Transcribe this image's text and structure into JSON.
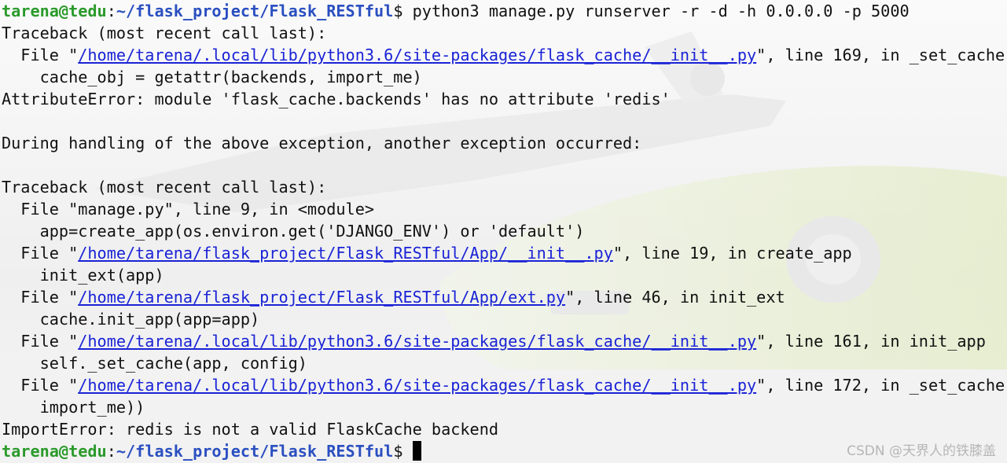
{
  "prompt": {
    "user_host": "tarena@tedu",
    "colon": ":",
    "path": "~/flask_project/Flask_RESTful",
    "symbol": "$",
    "command": " python3 manage.py runserver -r -d -h 0.0.0.0 -p 5000"
  },
  "output": {
    "tb1_header": "Traceback (most recent call last):",
    "tb1_file_pre": "  File \"",
    "tb1_file_link": "/home/tarena/.local/lib/python3.6/site-packages/flask_cache/__init__.py",
    "tb1_file_post": "\", line 169, in _set_cache",
    "tb1_code": "    cache_obj = getattr(backends, import_me)",
    "tb1_error": "AttributeError: module 'flask_cache.backends' has no attribute 'redis'",
    "during": "During handling of the above exception, another exception occurred:",
    "tb2_header": "Traceback (most recent call last):",
    "f1": "  File \"manage.py\", line 9, in <module>",
    "f1_code": "    app=create_app(os.environ.get('DJANGO_ENV') or 'default')",
    "f2_pre": "  File \"",
    "f2_link": "/home/tarena/flask_project/Flask_RESTful/App/__init__.py",
    "f2_post": "\", line 19, in create_app",
    "f2_code": "    init_ext(app)",
    "f3_pre": "  File \"",
    "f3_link": "/home/tarena/flask_project/Flask_RESTful/App/ext.py",
    "f3_post": "\", line 46, in init_ext",
    "f3_code": "    cache.init_app(app=app)",
    "f4_pre": "  File \"",
    "f4_link": "/home/tarena/.local/lib/python3.6/site-packages/flask_cache/__init__.py",
    "f4_post": "\", line 161, in init_app",
    "f4_code": "    self._set_cache(app, config)",
    "f5_pre": "  File \"",
    "f5_link": "/home/tarena/.local/lib/python3.6/site-packages/flask_cache/__init__.py",
    "f5_post": "\", line 172, in _set_cache",
    "f5_code": "    import_me))",
    "final_error": "ImportError: redis is not a valid FlaskCache backend"
  },
  "watermark": "CSDN @天界人的铁膝盖",
  "colors": {
    "user_host": "#2a9a2a",
    "path": "#2a4fc0",
    "link": "#1a23d6",
    "text": "#111111"
  }
}
